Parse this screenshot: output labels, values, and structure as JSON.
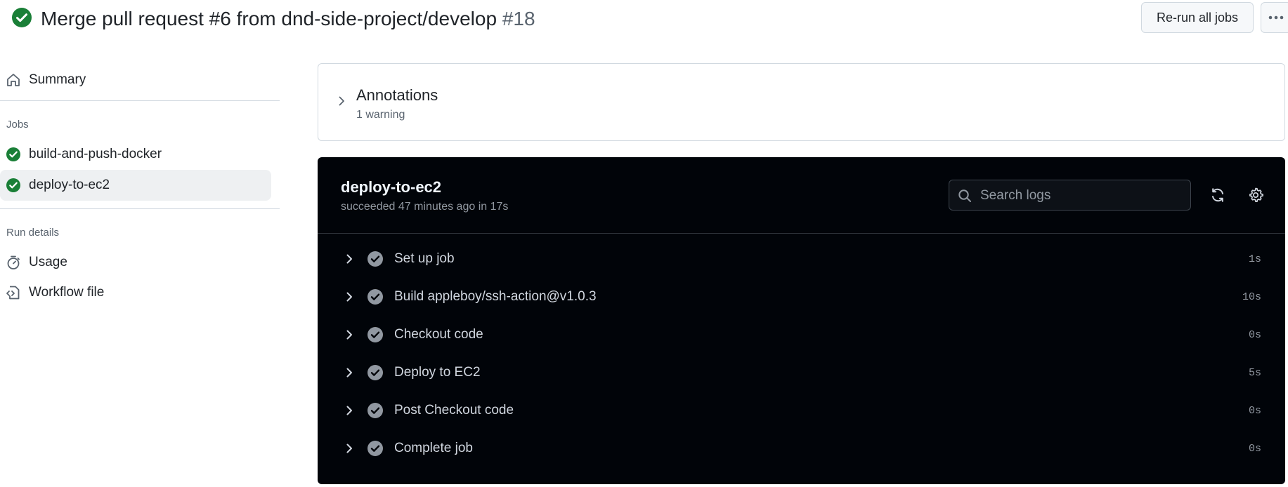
{
  "header": {
    "title": "Merge pull request #6 from dnd-side-project/develop",
    "run_number": "#18",
    "rerun_label": "Re-run all jobs",
    "more_icon": "kebab-horizontal-icon",
    "status_color": "#1a7f37"
  },
  "sidebar": {
    "summary_label": "Summary",
    "jobs_heading": "Jobs",
    "jobs": [
      {
        "label": "build-and-push-docker",
        "status": "success"
      },
      {
        "label": "deploy-to-ec2",
        "status": "success",
        "active": true
      }
    ],
    "run_details_heading": "Run details",
    "usage_label": "Usage",
    "workflow_file_label": "Workflow file"
  },
  "annotations": {
    "title": "Annotations",
    "count_text": "1 warning"
  },
  "job": {
    "name": "deploy-to-ec2",
    "status_text": "succeeded 47 minutes ago in 17s",
    "search_placeholder": "Search logs",
    "steps": [
      {
        "name": "Set up job",
        "duration": "1s"
      },
      {
        "name": "Build appleboy/ssh-action@v1.0.3",
        "duration": "10s"
      },
      {
        "name": "Checkout code",
        "duration": "0s"
      },
      {
        "name": "Deploy to EC2",
        "duration": "5s"
      },
      {
        "name": "Post Checkout code",
        "duration": "0s"
      },
      {
        "name": "Complete job",
        "duration": "0s"
      }
    ]
  }
}
